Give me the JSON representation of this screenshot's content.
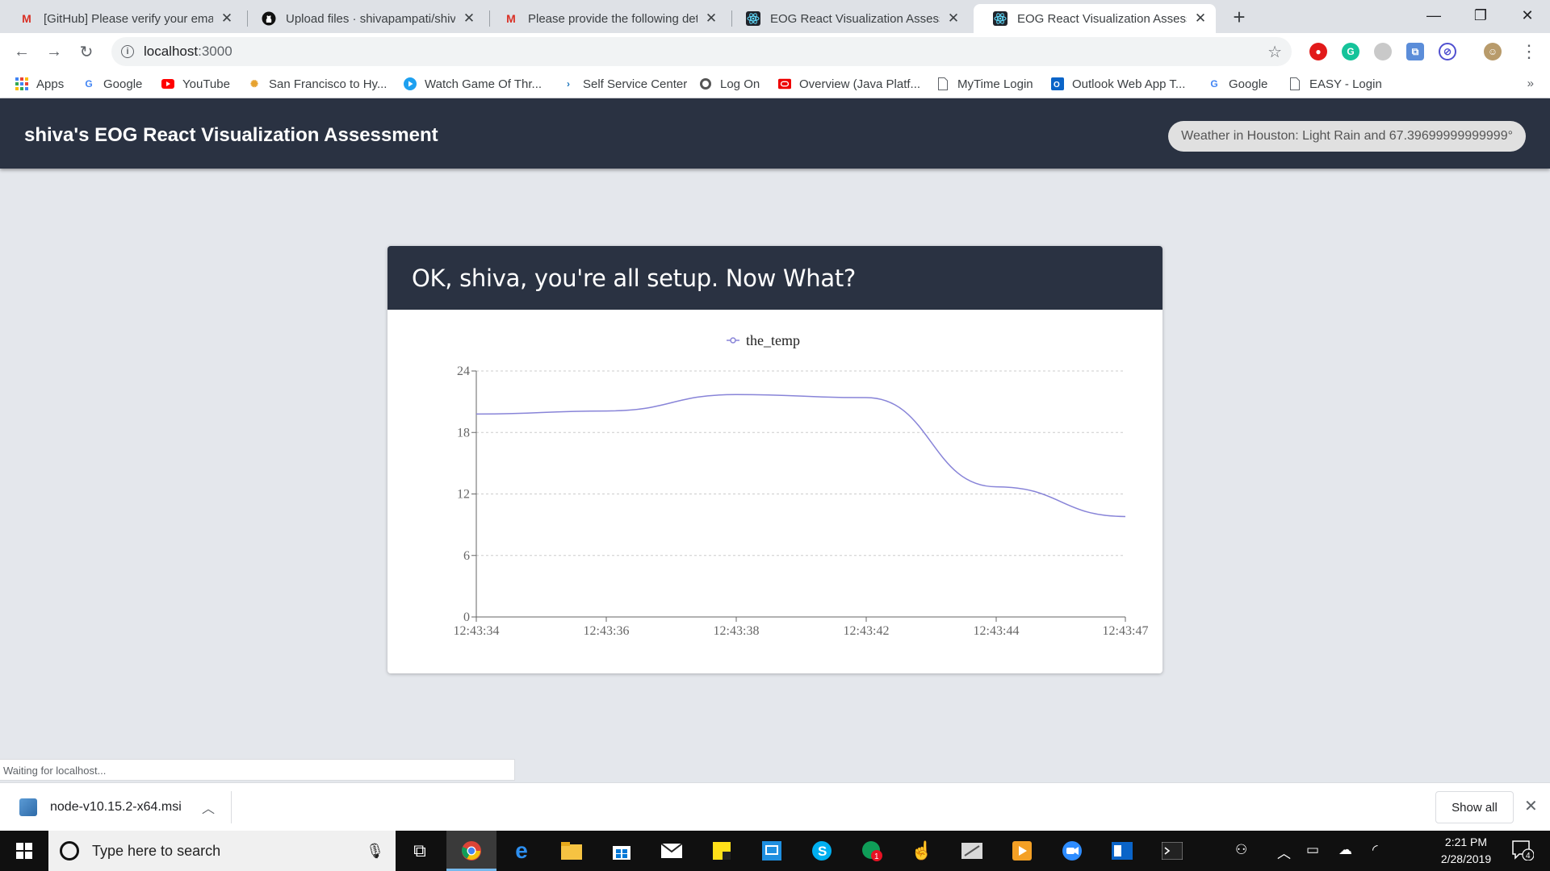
{
  "browser": {
    "tabs": [
      {
        "title": "[GitHub] Please verify your email",
        "icon": "gmail-icon",
        "active": false
      },
      {
        "title": "Upload files · shivapampati/shiva",
        "icon": "github-icon",
        "active": false
      },
      {
        "title": "Please provide the following deta",
        "icon": "gmail-icon",
        "active": false
      },
      {
        "title": "EOG React Visualization Assessm",
        "icon": "react-icon",
        "active": false
      },
      {
        "title": "EOG React Visualization Assessm",
        "icon": "react-icon",
        "active": true
      }
    ],
    "url_host": "localhost",
    "url_port": ":3000",
    "bookmarks": [
      {
        "label": "Apps",
        "icon": "apps-grid-icon"
      },
      {
        "label": "Google",
        "icon": "google-icon"
      },
      {
        "label": "YouTube",
        "icon": "youtube-icon"
      },
      {
        "label": "San Francisco to Hy...",
        "icon": "pinwheel-icon"
      },
      {
        "label": "Watch Game Of Thr...",
        "icon": "play-circle-icon"
      },
      {
        "label": "Self Service Center",
        "icon": "chevron-arrow-icon"
      },
      {
        "label": "Log On",
        "icon": "globe-icon"
      },
      {
        "label": "Overview (Java Platf...",
        "icon": "oracle-icon"
      },
      {
        "label": "MyTime Login",
        "icon": "page-icon"
      },
      {
        "label": "Outlook Web App T...",
        "icon": "outlook-icon"
      },
      {
        "label": "Google",
        "icon": "google-icon"
      },
      {
        "label": "EASY - Login",
        "icon": "page-icon"
      }
    ],
    "bookmarks_more": "»",
    "status_text": "Waiting for localhost..."
  },
  "app": {
    "title": "shiva's EOG React Visualization Assessment",
    "weather": "Weather in Houston: Light Rain and 67.39699999999999°",
    "card_title": "OK, shiva, you're all setup. Now What?"
  },
  "chart_data": {
    "type": "line",
    "series": [
      {
        "name": "the_temp",
        "color": "#8884d8",
        "x": [
          "12:43:34",
          "12:43:36",
          "12:43:38",
          "12:43:42",
          "12:43:44",
          "12:43:47"
        ],
        "values": [
          19.8,
          20.1,
          21.7,
          21.4,
          12.7,
          9.8
        ]
      }
    ],
    "x_ticks": [
      "12:43:34",
      "12:43:36",
      "12:43:38",
      "12:43:42",
      "12:43:44",
      "12:43:47"
    ],
    "y_ticks": [
      0,
      6,
      12,
      18,
      24
    ],
    "ylim": [
      0,
      24
    ],
    "grid": "dashed horizontal",
    "legend_position": "top"
  },
  "downloads": {
    "file_name": "node-v10.15.2-x64.msi",
    "show_all": "Show all"
  },
  "taskbar": {
    "search_placeholder": "Type here to search",
    "time": "2:21 PM",
    "date": "2/28/2019",
    "notification_count": "4",
    "badge_count": "1"
  }
}
